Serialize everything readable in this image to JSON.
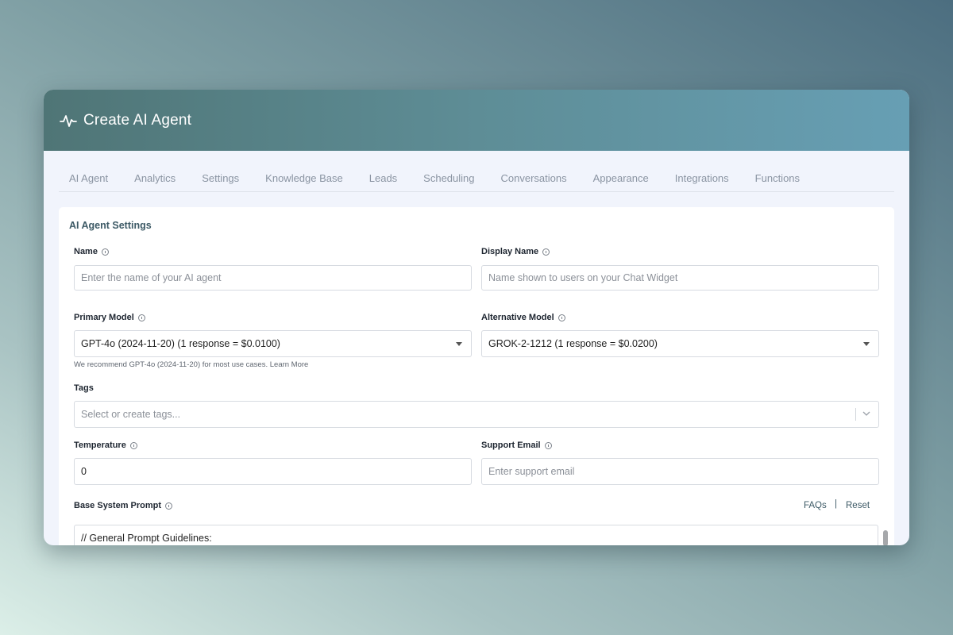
{
  "header": {
    "title": "Create AI Agent",
    "icon": "activity-pulse-icon"
  },
  "tabs": [
    {
      "label": "AI Agent"
    },
    {
      "label": "Analytics"
    },
    {
      "label": "Settings"
    },
    {
      "label": "Knowledge Base"
    },
    {
      "label": "Leads"
    },
    {
      "label": "Scheduling"
    },
    {
      "label": "Conversations"
    },
    {
      "label": "Appearance"
    },
    {
      "label": "Integrations"
    },
    {
      "label": "Functions"
    }
  ],
  "settings": {
    "title": "AI Agent Settings",
    "name": {
      "label": "Name",
      "value": "",
      "placeholder": "Enter the name of your AI agent"
    },
    "display_name": {
      "label": "Display Name",
      "value": "",
      "placeholder": "Name shown to users on your Chat Widget"
    },
    "primary_model": {
      "label": "Primary Model",
      "value": "GPT-4o (2024-11-20) (1 response = $0.0100)",
      "helper": "We recommend GPT-4o (2024-11-20) for most use cases. Learn More"
    },
    "alternative_model": {
      "label": "Alternative Model",
      "value": "GROK-2-1212 (1 response = $0.0200)"
    },
    "tags": {
      "label": "Tags",
      "placeholder": "Select or create tags..."
    },
    "temperature": {
      "label": "Temperature",
      "value": "0",
      "placeholder": ""
    },
    "support_email": {
      "label": "Support Email",
      "value": "",
      "placeholder": "Enter support email"
    },
    "base_prompt": {
      "label": "Base System Prompt",
      "faqs": "FAQs",
      "separator": "|",
      "reset": "Reset",
      "value": "// General Prompt Guidelines:"
    }
  },
  "colors": {
    "accent": "#3d5a66",
    "header_start": "#4f7576",
    "header_end": "#679fb4"
  }
}
